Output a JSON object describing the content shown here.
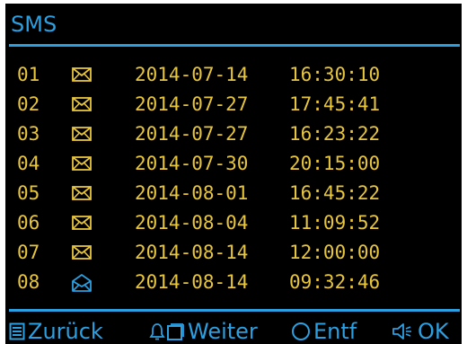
{
  "title": "SMS",
  "colors": {
    "accent": "#2c9fe0",
    "text": "#e8c63c",
    "background": "#000000"
  },
  "messages": [
    {
      "num": "01",
      "icon": "envelope-closed-icon",
      "date": "2014-07-14",
      "time": "16:30:10"
    },
    {
      "num": "02",
      "icon": "envelope-closed-icon",
      "date": "2014-07-27",
      "time": "17:45:41"
    },
    {
      "num": "03",
      "icon": "envelope-closed-icon",
      "date": "2014-07-27",
      "time": "16:23:22"
    },
    {
      "num": "04",
      "icon": "envelope-closed-icon",
      "date": "2014-07-30",
      "time": "20:15:00"
    },
    {
      "num": "05",
      "icon": "envelope-closed-icon",
      "date": "2014-08-01",
      "time": "16:45:22"
    },
    {
      "num": "06",
      "icon": "envelope-closed-icon",
      "date": "2014-08-04",
      "time": "11:09:52"
    },
    {
      "num": "07",
      "icon": "envelope-closed-icon",
      "date": "2014-08-14",
      "time": "12:00:00"
    },
    {
      "num": "08",
      "icon": "envelope-open-icon",
      "date": "2014-08-14",
      "time": "09:32:46"
    }
  ],
  "footer": {
    "back_label": "Zurück",
    "back_icon": "menu-list-icon",
    "next_label": "Weiter",
    "next_icon": "bell-square-icon",
    "delete_label": "Entf",
    "delete_icon": "circle-icon",
    "ok_label": "OK",
    "ok_icon": "speaker-icon"
  }
}
